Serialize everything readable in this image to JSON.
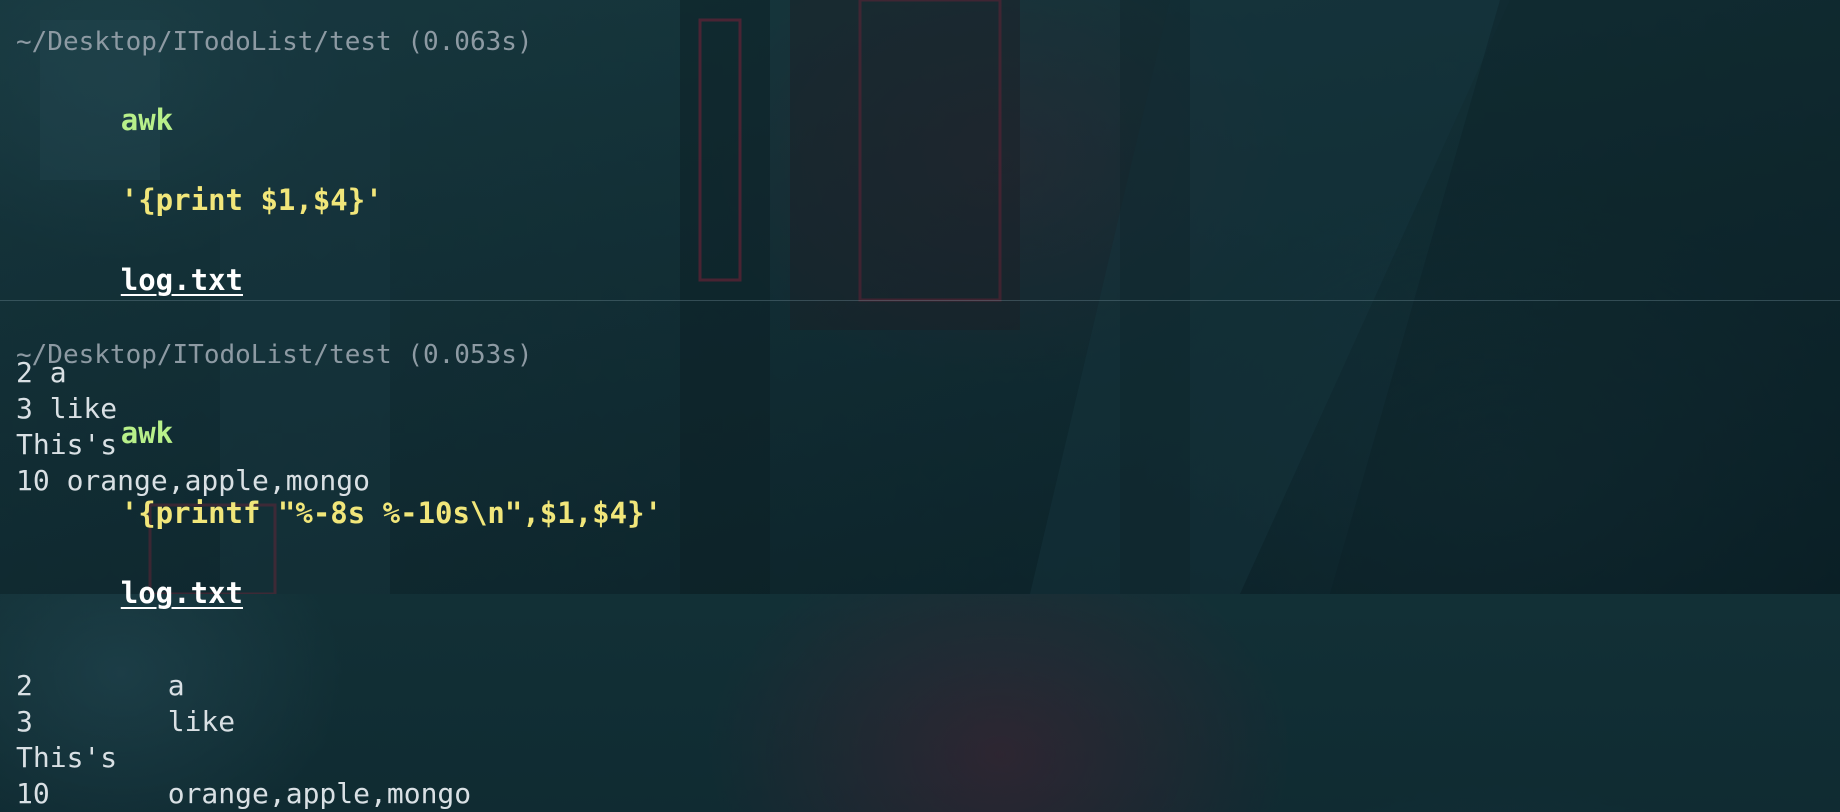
{
  "theme": {
    "command_color": "#b8f08a",
    "argument_color": "#f1e67a",
    "file_color": "#ffffff",
    "path_color": "#8d9aa3",
    "output_color": "#d9e0e4",
    "background": "#102b31"
  },
  "blocks": [
    {
      "path": "~/Desktop/ITodoList/test (0.063s)",
      "command": "awk",
      "argument": "'{print $1,$4}'",
      "file": "log.txt",
      "output": [
        "2 a",
        "3 like",
        "This's",
        "10 orange,apple,mongo"
      ]
    },
    {
      "path": "~/Desktop/ITodoList/test (0.053s)",
      "command": "awk",
      "argument": "'{printf \"%-8s %-10s\\n\",$1,$4}'",
      "file": "log.txt",
      "output": [
        "2        a",
        "3        like",
        "This's",
        "10       orange,apple,mongo"
      ]
    }
  ]
}
